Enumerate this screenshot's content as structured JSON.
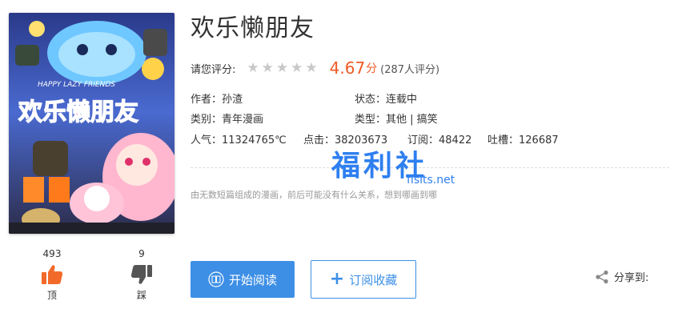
{
  "comic": {
    "title": "欢乐懒朋友",
    "cover_title_en": "HAPPY LAZY FRIENDS",
    "cover_title_cn": "欢乐懒朋友"
  },
  "rating": {
    "label": "请您评分:",
    "stars_total": 5,
    "score": "4.67",
    "score_unit": "分",
    "count_text": "(287人评分)"
  },
  "info": {
    "author": "作者：孙渣",
    "status": "状态：连载中",
    "category": "类别：青年漫画",
    "type": "类型：其他 | 搞笑",
    "popularity": "人气：11324765℃",
    "clicks": "点击：38203673",
    "subscriptions": "订阅：48422",
    "comments": "吐槽：126687"
  },
  "description": "由无数短篇组成的漫画，前后可能没有什么关系，想到哪画到哪",
  "watermark": {
    "main": "福利社",
    "sub": "flslts.net"
  },
  "votes": {
    "up_count": "493",
    "up_label": "顶",
    "down_count": "9",
    "down_label": "踩"
  },
  "actions": {
    "read_label": "开始阅读",
    "subscribe_label": "订阅收藏",
    "share_label": "分享到:"
  },
  "colors": {
    "accent": "#3d8fe6",
    "score": "#f05a24",
    "vote_up": "#f26a2a",
    "vote_down": "#555555"
  }
}
